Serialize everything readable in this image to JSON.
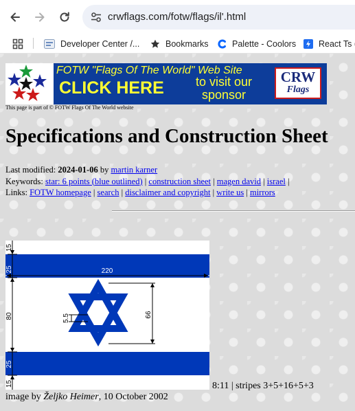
{
  "browser": {
    "url": "crwflags.com/fotw/flags/il'.html",
    "bookmarks": [
      {
        "label": "Developer Center /...",
        "icon": "developer-center-favicon"
      },
      {
        "label": "Bookmarks",
        "icon": "star-icon"
      },
      {
        "label": "Palette - Coolors",
        "icon": "coolors-favicon"
      },
      {
        "label": "React Ts (f",
        "icon": "lightning-favicon"
      }
    ]
  },
  "banner": {
    "line1": "FOTW \"Flags Of The World\" Web Site",
    "line2": "CLICK HERE",
    "line3": "to visit our sponsor",
    "logo_top": "CRW",
    "logo_bottom": "Flags",
    "note": "This page is part of © FOTW Flags Of The World website"
  },
  "page": {
    "title": "Specifications and Construction Sheet",
    "last_modified_label": "Last modified:",
    "last_modified_date": "2024-01-06",
    "by_label": "by",
    "author": "martin karner",
    "keywords_label": "Keywords:",
    "keywords": [
      "star: 6 points (blue outlined)",
      "construction sheet",
      "magen david",
      "israel"
    ],
    "links_label": "Links:",
    "links": [
      "FOTW homepage",
      "search",
      "disclaimer and copyright",
      "write us",
      "mirrors"
    ]
  },
  "flag": {
    "dimensions": {
      "top_margin": "15",
      "top_stripe": "25",
      "width": "220",
      "middle": "80",
      "star_gap": "5.5",
      "star_height": "66",
      "bottom_stripe": "25",
      "bottom_margin": "15"
    },
    "colors": {
      "blue": "#0038b8",
      "white": "#ffffff"
    },
    "caption": "8:11 | stripes 3+5+16+5+3",
    "credit_prefix": "image by",
    "credit_author": "Željko Heimer",
    "credit_date": ", 10 October 2002"
  }
}
